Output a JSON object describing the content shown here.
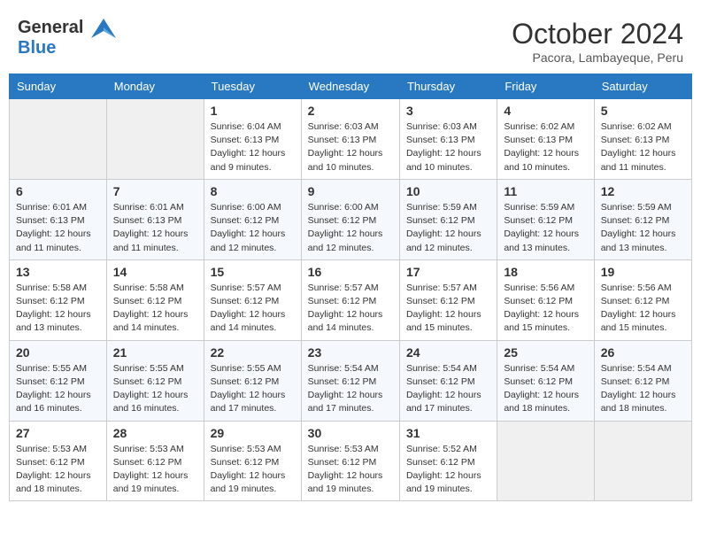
{
  "logo": {
    "line1": "General",
    "line2": "Blue"
  },
  "header": {
    "month": "October 2024",
    "location": "Pacora, Lambayeque, Peru"
  },
  "weekdays": [
    "Sunday",
    "Monday",
    "Tuesday",
    "Wednesday",
    "Thursday",
    "Friday",
    "Saturday"
  ],
  "weeks": [
    [
      {
        "day": "",
        "info": ""
      },
      {
        "day": "",
        "info": ""
      },
      {
        "day": "1",
        "info": "Sunrise: 6:04 AM\nSunset: 6:13 PM\nDaylight: 12 hours and 9 minutes."
      },
      {
        "day": "2",
        "info": "Sunrise: 6:03 AM\nSunset: 6:13 PM\nDaylight: 12 hours and 10 minutes."
      },
      {
        "day": "3",
        "info": "Sunrise: 6:03 AM\nSunset: 6:13 PM\nDaylight: 12 hours and 10 minutes."
      },
      {
        "day": "4",
        "info": "Sunrise: 6:02 AM\nSunset: 6:13 PM\nDaylight: 12 hours and 10 minutes."
      },
      {
        "day": "5",
        "info": "Sunrise: 6:02 AM\nSunset: 6:13 PM\nDaylight: 12 hours and 11 minutes."
      }
    ],
    [
      {
        "day": "6",
        "info": "Sunrise: 6:01 AM\nSunset: 6:13 PM\nDaylight: 12 hours and 11 minutes."
      },
      {
        "day": "7",
        "info": "Sunrise: 6:01 AM\nSunset: 6:13 PM\nDaylight: 12 hours and 11 minutes."
      },
      {
        "day": "8",
        "info": "Sunrise: 6:00 AM\nSunset: 6:12 PM\nDaylight: 12 hours and 12 minutes."
      },
      {
        "day": "9",
        "info": "Sunrise: 6:00 AM\nSunset: 6:12 PM\nDaylight: 12 hours and 12 minutes."
      },
      {
        "day": "10",
        "info": "Sunrise: 5:59 AM\nSunset: 6:12 PM\nDaylight: 12 hours and 12 minutes."
      },
      {
        "day": "11",
        "info": "Sunrise: 5:59 AM\nSunset: 6:12 PM\nDaylight: 12 hours and 13 minutes."
      },
      {
        "day": "12",
        "info": "Sunrise: 5:59 AM\nSunset: 6:12 PM\nDaylight: 12 hours and 13 minutes."
      }
    ],
    [
      {
        "day": "13",
        "info": "Sunrise: 5:58 AM\nSunset: 6:12 PM\nDaylight: 12 hours and 13 minutes."
      },
      {
        "day": "14",
        "info": "Sunrise: 5:58 AM\nSunset: 6:12 PM\nDaylight: 12 hours and 14 minutes."
      },
      {
        "day": "15",
        "info": "Sunrise: 5:57 AM\nSunset: 6:12 PM\nDaylight: 12 hours and 14 minutes."
      },
      {
        "day": "16",
        "info": "Sunrise: 5:57 AM\nSunset: 6:12 PM\nDaylight: 12 hours and 14 minutes."
      },
      {
        "day": "17",
        "info": "Sunrise: 5:57 AM\nSunset: 6:12 PM\nDaylight: 12 hours and 15 minutes."
      },
      {
        "day": "18",
        "info": "Sunrise: 5:56 AM\nSunset: 6:12 PM\nDaylight: 12 hours and 15 minutes."
      },
      {
        "day": "19",
        "info": "Sunrise: 5:56 AM\nSunset: 6:12 PM\nDaylight: 12 hours and 15 minutes."
      }
    ],
    [
      {
        "day": "20",
        "info": "Sunrise: 5:55 AM\nSunset: 6:12 PM\nDaylight: 12 hours and 16 minutes."
      },
      {
        "day": "21",
        "info": "Sunrise: 5:55 AM\nSunset: 6:12 PM\nDaylight: 12 hours and 16 minutes."
      },
      {
        "day": "22",
        "info": "Sunrise: 5:55 AM\nSunset: 6:12 PM\nDaylight: 12 hours and 17 minutes."
      },
      {
        "day": "23",
        "info": "Sunrise: 5:54 AM\nSunset: 6:12 PM\nDaylight: 12 hours and 17 minutes."
      },
      {
        "day": "24",
        "info": "Sunrise: 5:54 AM\nSunset: 6:12 PM\nDaylight: 12 hours and 17 minutes."
      },
      {
        "day": "25",
        "info": "Sunrise: 5:54 AM\nSunset: 6:12 PM\nDaylight: 12 hours and 18 minutes."
      },
      {
        "day": "26",
        "info": "Sunrise: 5:54 AM\nSunset: 6:12 PM\nDaylight: 12 hours and 18 minutes."
      }
    ],
    [
      {
        "day": "27",
        "info": "Sunrise: 5:53 AM\nSunset: 6:12 PM\nDaylight: 12 hours and 18 minutes."
      },
      {
        "day": "28",
        "info": "Sunrise: 5:53 AM\nSunset: 6:12 PM\nDaylight: 12 hours and 19 minutes."
      },
      {
        "day": "29",
        "info": "Sunrise: 5:53 AM\nSunset: 6:12 PM\nDaylight: 12 hours and 19 minutes."
      },
      {
        "day": "30",
        "info": "Sunrise: 5:53 AM\nSunset: 6:12 PM\nDaylight: 12 hours and 19 minutes."
      },
      {
        "day": "31",
        "info": "Sunrise: 5:52 AM\nSunset: 6:12 PM\nDaylight: 12 hours and 19 minutes."
      },
      {
        "day": "",
        "info": ""
      },
      {
        "day": "",
        "info": ""
      }
    ]
  ]
}
